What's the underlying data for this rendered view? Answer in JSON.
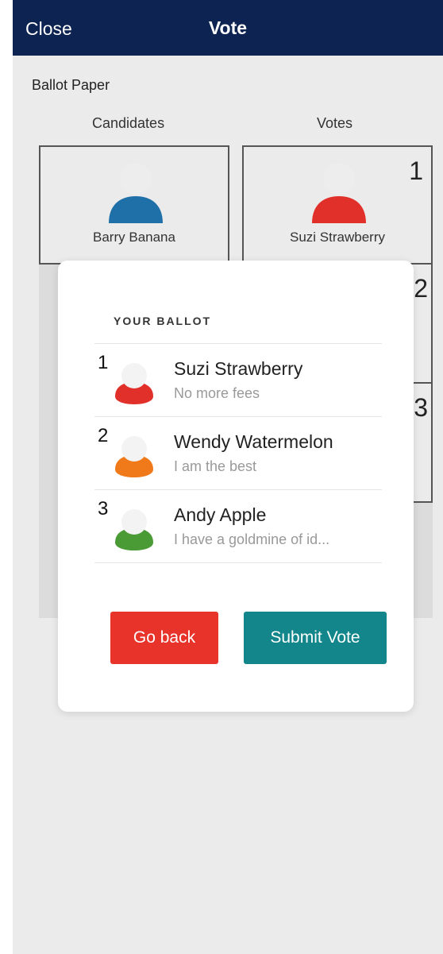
{
  "header": {
    "close_label": "Close",
    "title": "Vote"
  },
  "ballot": {
    "label": "Ballot Paper",
    "candidates_header": "Candidates",
    "votes_header": "Votes",
    "candidate_card": {
      "name": "Barry Banana",
      "color": "#1f6fa8"
    },
    "vote_card": {
      "rank": "1",
      "name": "Suzi Strawberry",
      "color": "#e1302a"
    },
    "slot_ranks": [
      "2",
      "3"
    ]
  },
  "modal": {
    "heading": "YOUR BALLOT",
    "rows": [
      {
        "rank": "1",
        "name": "Suzi Strawberry",
        "motto": "No more fees",
        "color": "#e1302a"
      },
      {
        "rank": "2",
        "name": "Wendy Watermelon",
        "motto": "I am the best",
        "color": "#f07a1a"
      },
      {
        "rank": "3",
        "name": "Andy Apple",
        "motto": "I have a goldmine of id...",
        "color": "#4a9a36"
      }
    ],
    "back_label": "Go back",
    "submit_label": "Submit Vote",
    "colors": {
      "back": "#e8332a",
      "submit": "#12868a"
    }
  }
}
